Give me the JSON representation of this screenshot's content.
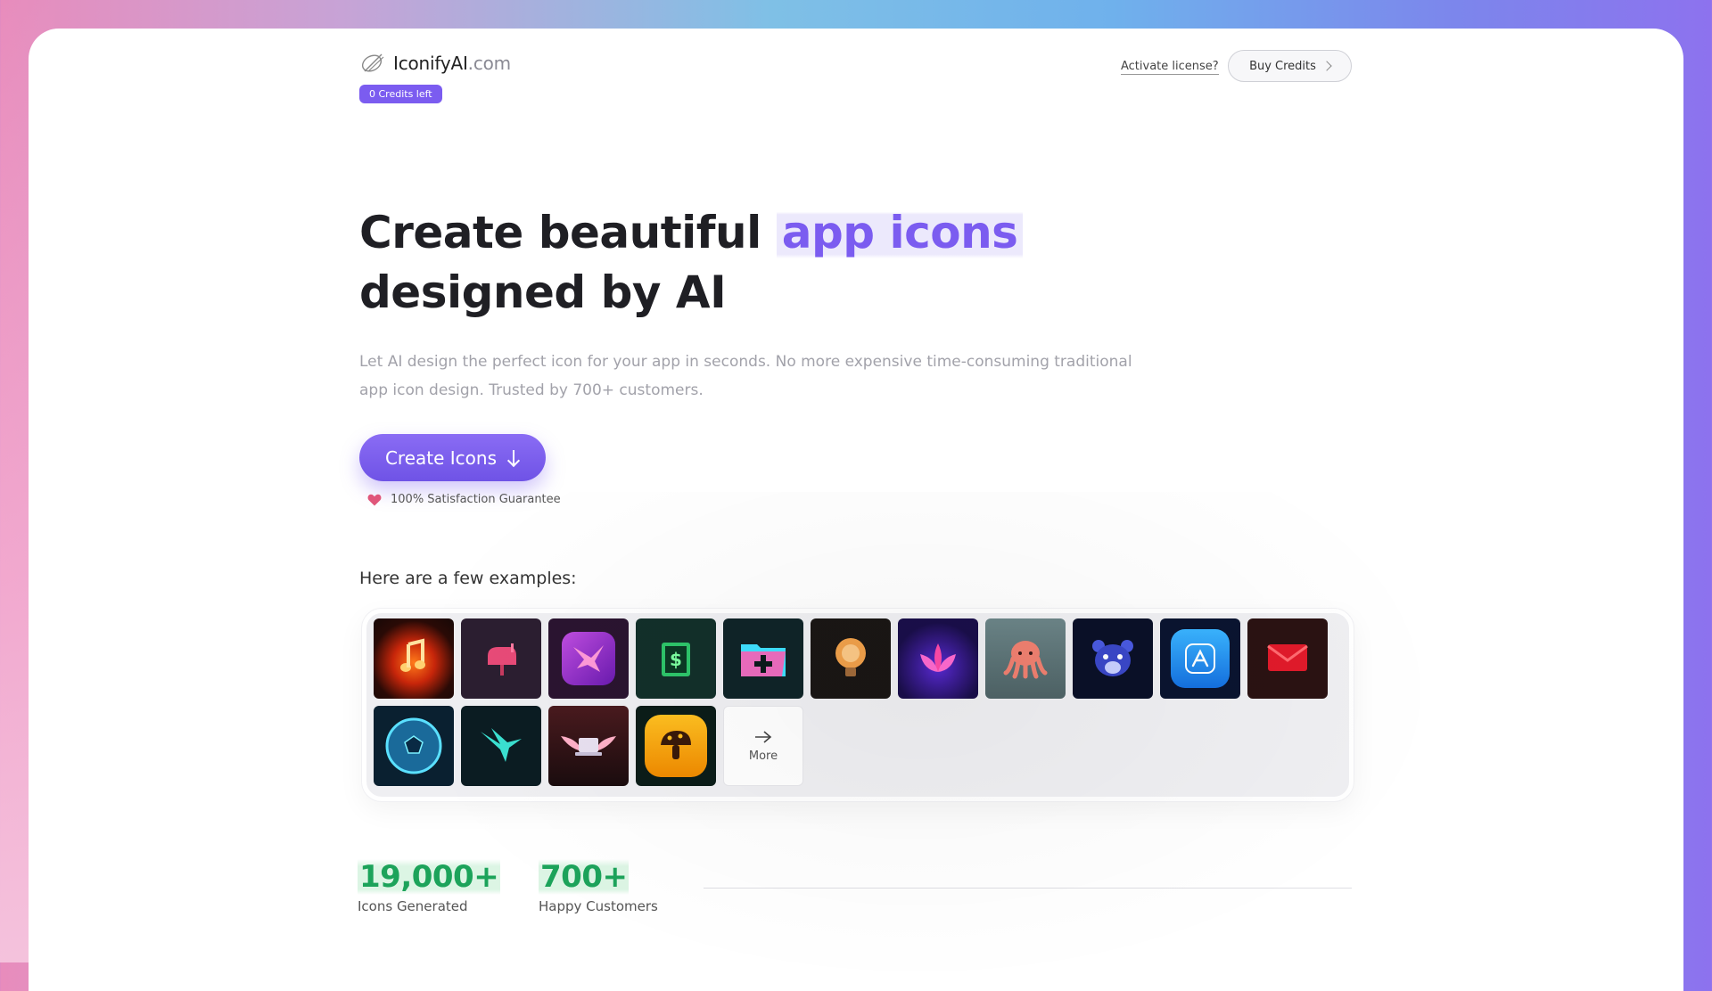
{
  "header": {
    "logo_name": "IconifyAI",
    "logo_domain": ".com",
    "credits_badge": "0 Credits left",
    "activate_link": "Activate license?",
    "buy_button": "Buy Credits"
  },
  "hero": {
    "title_part1": "Create beautiful",
    "title_highlight": "app icons",
    "title_part2": "designed by AI",
    "subtitle": "Let AI design the perfect icon for your app in seconds. No more expensive time-consuming traditional app icon design. Trusted by 700+ customers.",
    "cta_label": "Create Icons",
    "guarantee": "100% Satisfaction Guarantee"
  },
  "examples": {
    "title": "Here are a few examples:",
    "more_label": "More",
    "icons": [
      {
        "name": "music-flame-icon",
        "bg": "#1a0e0c"
      },
      {
        "name": "mailbox-icon",
        "bg": "#2a1c2e"
      },
      {
        "name": "bird-icon",
        "bg": "#2a1430"
      },
      {
        "name": "money-book-icon",
        "bg": "#0f2a26"
      },
      {
        "name": "folder-plus-icon",
        "bg": "#0f2428"
      },
      {
        "name": "lightbulb-icon",
        "bg": "#171312"
      },
      {
        "name": "lotus-icon",
        "bg": "#1a0e4a"
      },
      {
        "name": "octopus-icon",
        "bg": "#5d7478"
      },
      {
        "name": "bear-icon",
        "bg": "#0a1028"
      },
      {
        "name": "app-store-icon",
        "bg": "#0a1430"
      },
      {
        "name": "envelope-icon",
        "bg": "#2a1010"
      },
      {
        "name": "soccer-ball-icon",
        "bg": "#0a2030"
      },
      {
        "name": "hummingbird-icon",
        "bg": "#0a1a20"
      },
      {
        "name": "winged-laptop-icon",
        "bg": "#3a1416"
      },
      {
        "name": "mushroom-icon",
        "bg": "#0a1a16"
      }
    ]
  },
  "stats": [
    {
      "number": "19,000+",
      "label": "Icons Generated"
    },
    {
      "number": "700+",
      "label": "Happy Customers"
    }
  ],
  "colors": {
    "accent": "#7b5cf0",
    "stat_green": "#1ca35a"
  }
}
